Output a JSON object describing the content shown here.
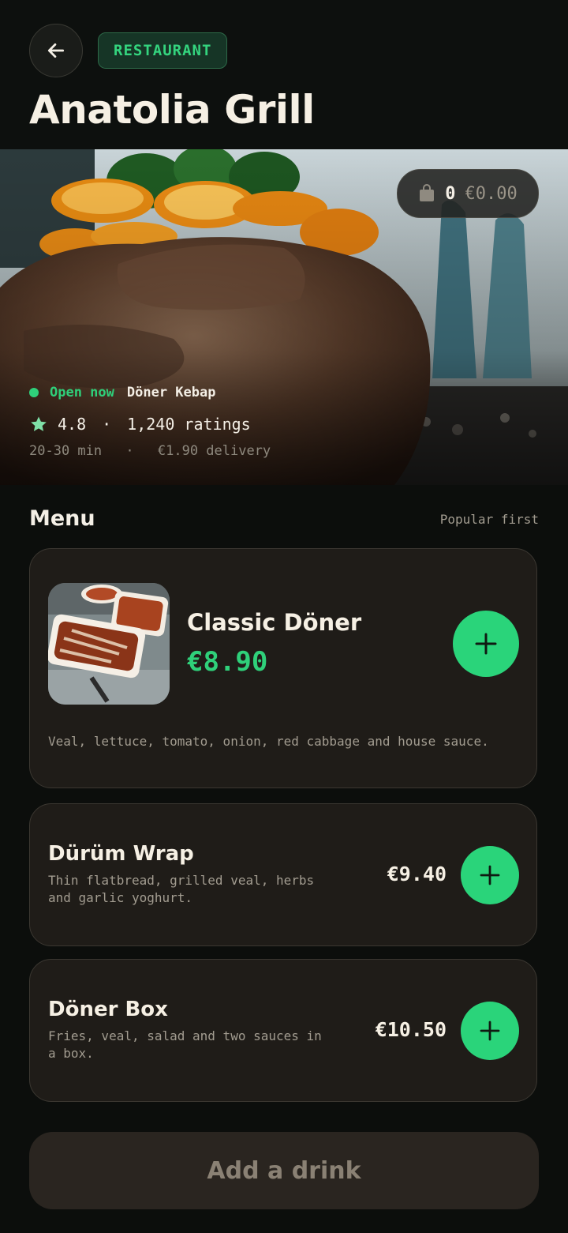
{
  "header": {
    "back_icon": "arrow-left-icon",
    "category_chip": "RESTAURANT",
    "title": "Anatolia Grill"
  },
  "cart": {
    "icon": "shopping-bag-icon",
    "count": "0",
    "total": "€0.00"
  },
  "restaurant": {
    "status": "Open now",
    "cuisine": "Döner Kebap",
    "rating": "4.8",
    "separator": "·",
    "ratings_count": "1,240 ratings",
    "delivery_time": "20-30 min",
    "delivery_fee": "€1.90 delivery"
  },
  "menu": {
    "title": "Menu",
    "sort_label": "Popular first",
    "items": [
      {
        "name": "Classic Döner",
        "price": "€8.90",
        "description": "Veal, lettuce, tomato, onion, red cabbage and house sauce."
      },
      {
        "name": "Dürüm Wrap",
        "price": "€9.40",
        "description": "Thin flatbread, grilled veal, herbs and garlic yoghurt."
      },
      {
        "name": "Döner Box",
        "price": "€10.50",
        "description": "Fries, veal, salad and two sauces in a box."
      }
    ]
  },
  "footer": {
    "drink_button": "Add a drink"
  },
  "colors": {
    "accent": "#2ad47a",
    "background": "#0c0e0c",
    "card": "#1f1c18"
  }
}
